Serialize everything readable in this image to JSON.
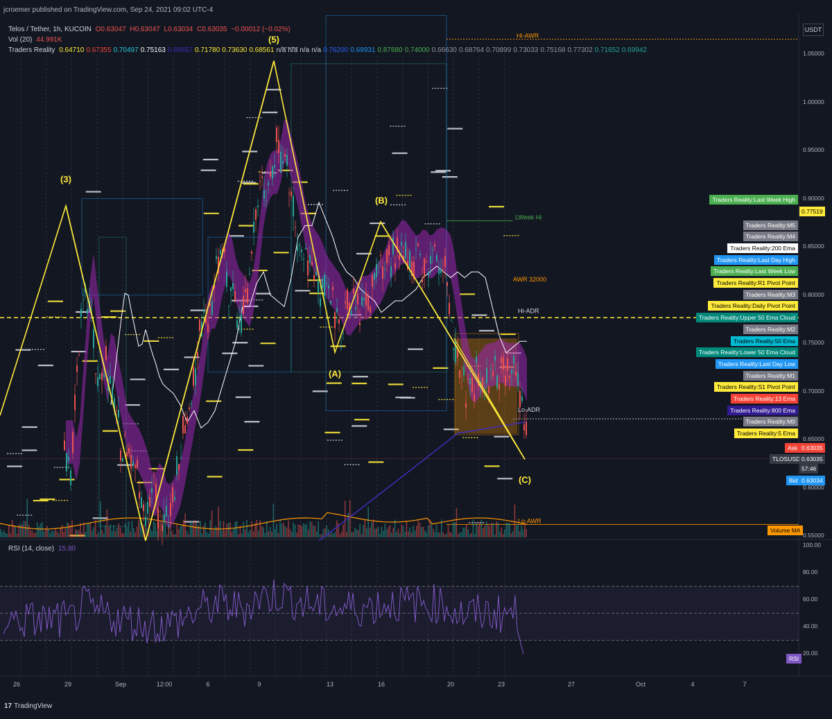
{
  "publish_line": "jcroemer published on TradingView.com, Sep 24, 2021 09:02 UTC-4",
  "footer_brand": "TradingView",
  "header": {
    "symbol": "Telos / Tether, 1h, KUCOIN",
    "o": "O0.63047",
    "h": "H0.63047",
    "l": "L0.63034",
    "c": "C0.63035",
    "chg": "−0.00012 (−0.02%)",
    "vol_label": "Vol (20)",
    "vol_value": "44.991K",
    "tr_label": "Traders Reality",
    "tr_values": [
      {
        "v": "0.64710",
        "c": "#ffeb3b"
      },
      {
        "v": "0.67355",
        "c": "#f44336"
      },
      {
        "v": "0.70497",
        "c": "#26c6da"
      },
      {
        "v": "0.75163",
        "c": "#ffffff"
      },
      {
        "v": "0.66657",
        "c": "#3f2ebd"
      },
      {
        "v": "0.71780",
        "c": "#ffeb3b"
      },
      {
        "v": "0.73630",
        "c": "#ffeb3b"
      },
      {
        "v": "0.68561",
        "c": "#ffeb3b"
      },
      {
        "v": "n/a",
        "c": "#d1d4dc"
      },
      {
        "v": "n/a",
        "c": "#d1d4dc"
      },
      {
        "v": "n/a",
        "c": "#d1d4dc"
      },
      {
        "v": "n/a",
        "c": "#d1d4dc"
      },
      {
        "v": "0.76200",
        "c": "#2962ff"
      },
      {
        "v": "0.69931",
        "c": "#2196f3"
      },
      {
        "v": "0.87680",
        "c": "#4caf50"
      },
      {
        "v": "0.74000",
        "c": "#4caf50"
      },
      {
        "v": "0.66630",
        "c": "#9598a1"
      },
      {
        "v": "0.68764",
        "c": "#9598a1"
      },
      {
        "v": "0.70899",
        "c": "#9598a1"
      },
      {
        "v": "0.73033",
        "c": "#9598a1"
      },
      {
        "v": "0.75168",
        "c": "#9598a1"
      },
      {
        "v": "0.77302",
        "c": "#9598a1"
      },
      {
        "v": "0.71652",
        "c": "#26a69a"
      },
      {
        "v": "0.69942",
        "c": "#26a69a"
      }
    ]
  },
  "currency": "USDT",
  "rsi_label": "RSI (14, close)",
  "rsi_value": "15.80",
  "rsi_tag": "RSI",
  "ask_label": "Ask",
  "ask_value": "0.63035",
  "sym_label": "TLOSUSDT",
  "sym_value": "0.63035",
  "countdown": "57:46",
  "bid_label": "Bid",
  "bid_value": "0.63034",
  "last_week_high_value": "0.77519",
  "volume_ma_tag": "Volume MA",
  "colors": {
    "background": "#131722",
    "up": "#26a69a",
    "down": "#ef5350",
    "ema_cloud": "#9c27b0",
    "elliott": "#ffeb3b"
  },
  "right_tags": [
    {
      "text": "Traders Reality:Last Week High",
      "bg": "#4caf50",
      "fg": "#ffffff",
      "price": 0.899
    },
    {
      "text": "Traders Reality:M5",
      "bg": "#787b86",
      "fg": "#ffffff",
      "price": 0.8725
    },
    {
      "text": "Traders Reality:M4",
      "bg": "#787b86",
      "fg": "#ffffff",
      "price": 0.8605
    },
    {
      "text": "Traders Reality:200 Ema",
      "bg": "#ffffff",
      "fg": "#000000",
      "price": 0.8485
    },
    {
      "text": "Traders Reality:Last Day High",
      "bg": "#2196f3",
      "fg": "#ffffff",
      "price": 0.8365
    },
    {
      "text": "Traders Reality:Last Week Low",
      "bg": "#4caf50",
      "fg": "#ffffff",
      "price": 0.8245
    },
    {
      "text": "Traders Reality:R1 Pivot Point",
      "bg": "#ffeb3b",
      "fg": "#000000",
      "price": 0.8125
    },
    {
      "text": "Traders Reality:M3",
      "bg": "#787b86",
      "fg": "#ffffff",
      "price": 0.8005
    },
    {
      "text": "Traders Reality:Daily Pivot Point",
      "bg": "#ffeb3b",
      "fg": "#000000",
      "price": 0.7885
    },
    {
      "text": "Traders Reality:Upper 50 Ema Cloud",
      "bg": "#00897b",
      "fg": "#ffffff",
      "price": 0.7765
    },
    {
      "text": "Traders Reality:M2",
      "bg": "#787b86",
      "fg": "#ffffff",
      "price": 0.7645
    },
    {
      "text": "Traders Reality:50 Ema",
      "bg": "#00bcd4",
      "fg": "#000000",
      "price": 0.7525
    },
    {
      "text": "Traders Reality:Lower 50 Ema Cloud",
      "bg": "#00897b",
      "fg": "#ffffff",
      "price": 0.7405
    },
    {
      "text": "Traders Reality:Last Day Low",
      "bg": "#2196f3",
      "fg": "#ffffff",
      "price": 0.7285
    },
    {
      "text": "Traders Reality:M1",
      "bg": "#787b86",
      "fg": "#ffffff",
      "price": 0.7165
    },
    {
      "text": "Traders Reality:S1 Pivot Point",
      "bg": "#ffeb3b",
      "fg": "#000000",
      "price": 0.7045
    },
    {
      "text": "Traders Reality:13 Ema",
      "bg": "#f44336",
      "fg": "#ffffff",
      "price": 0.6925
    },
    {
      "text": "Traders Reality:800 Ema",
      "bg": "#311b92",
      "fg": "#ffffff",
      "price": 0.6805
    },
    {
      "text": "Traders Reality:M0",
      "bg": "#787b86",
      "fg": "#ffffff",
      "price": 0.6685
    },
    {
      "text": "Traders Reality:5 Ema",
      "bg": "#ffeb3b",
      "fg": "#000000",
      "price": 0.6565
    }
  ],
  "level_labels": [
    {
      "text": "Hi-AWR",
      "color": "#ff9800",
      "price": 1.0655
    },
    {
      "text": "LWeek Hi",
      "color": "#4caf50",
      "price": 0.877
    },
    {
      "text": "AWR 32000",
      "color": "#ff9800",
      "price": 0.8125
    },
    {
      "text": "Hi-ADR",
      "color": "#d1d4dc",
      "price": 0.78
    },
    {
      "text": "Lo-ADR",
      "color": "#d1d4dc",
      "price": 0.6775
    },
    {
      "text": "Lo-AWR",
      "color": "#ff9800",
      "price": 0.562
    }
  ],
  "chart_data": {
    "type": "candlestick",
    "symbol": "TLOSUSDT",
    "ylim": [
      0.545,
      1.09
    ],
    "y_ticks": [
      "1.05000",
      "1.00000",
      "0.95000",
      "0.90000",
      "0.85000",
      "0.80000",
      "0.75000",
      "0.70000",
      "0.65000",
      "0.60000",
      "0.55000"
    ],
    "x_ticks": [
      {
        "label": "26",
        "x": 24
      },
      {
        "label": "29",
        "x": 98
      },
      {
        "label": "Sep",
        "x": 174
      },
      {
        "label": "12:00",
        "x": 237
      },
      {
        "label": "6",
        "x": 300
      },
      {
        "label": "9",
        "x": 374
      },
      {
        "label": "13",
        "x": 476
      },
      {
        "label": "16",
        "x": 550
      },
      {
        "label": "20",
        "x": 650
      },
      {
        "label": "23",
        "x": 723
      },
      {
        "label": "27",
        "x": 824
      },
      {
        "label": "Oct",
        "x": 924
      },
      {
        "label": "4",
        "x": 999
      },
      {
        "label": "7",
        "x": 1074
      }
    ],
    "price_path": [
      [
        95,
        0.64
      ],
      [
        100,
        0.61
      ],
      [
        108,
        0.69
      ],
      [
        115,
        0.76
      ],
      [
        122,
        0.82
      ],
      [
        128,
        0.78
      ],
      [
        135,
        0.74
      ],
      [
        142,
        0.7
      ],
      [
        150,
        0.74
      ],
      [
        158,
        0.705
      ],
      [
        165,
        0.68
      ],
      [
        172,
        0.65
      ],
      [
        180,
        0.64
      ],
      [
        190,
        0.63
      ],
      [
        200,
        0.61
      ],
      [
        210,
        0.58
      ],
      [
        220,
        0.6
      ],
      [
        230,
        0.57
      ],
      [
        240,
        0.58
      ],
      [
        250,
        0.6
      ],
      [
        260,
        0.64
      ],
      [
        270,
        0.68
      ],
      [
        280,
        0.72
      ],
      [
        290,
        0.78
      ],
      [
        300,
        0.78
      ],
      [
        310,
        0.82
      ],
      [
        320,
        0.84
      ],
      [
        330,
        0.8
      ],
      [
        340,
        0.79
      ],
      [
        350,
        0.78
      ],
      [
        360,
        0.83
      ],
      [
        370,
        0.9
      ],
      [
        380,
        0.92
      ],
      [
        390,
        0.92
      ],
      [
        400,
        0.96
      ],
      [
        410,
        0.93
      ],
      [
        420,
        0.9
      ],
      [
        430,
        0.86
      ],
      [
        440,
        0.84
      ],
      [
        450,
        0.83
      ],
      [
        460,
        0.81
      ],
      [
        470,
        0.8
      ],
      [
        480,
        0.79
      ],
      [
        490,
        0.77
      ],
      [
        500,
        0.78
      ],
      [
        510,
        0.79
      ],
      [
        520,
        0.79
      ],
      [
        530,
        0.8
      ],
      [
        540,
        0.81
      ],
      [
        550,
        0.83
      ],
      [
        560,
        0.84
      ],
      [
        570,
        0.85
      ],
      [
        580,
        0.84
      ],
      [
        590,
        0.83
      ],
      [
        600,
        0.84
      ],
      [
        610,
        0.83
      ],
      [
        620,
        0.84
      ],
      [
        630,
        0.84
      ],
      [
        640,
        0.83
      ],
      [
        650,
        0.78
      ],
      [
        660,
        0.73
      ],
      [
        670,
        0.7
      ],
      [
        680,
        0.71
      ],
      [
        690,
        0.72
      ],
      [
        700,
        0.72
      ],
      [
        710,
        0.725
      ],
      [
        720,
        0.72
      ],
      [
        730,
        0.72
      ],
      [
        740,
        0.72
      ],
      [
        750,
        0.7
      ],
      [
        756,
        0.66
      ],
      [
        760,
        0.63
      ]
    ],
    "elliott_wave": [
      {
        "label": "(3)",
        "x": 95,
        "price": 0.8925
      },
      {
        "label": "",
        "x": 210,
        "price": 0.545
      },
      {
        "label": "(5)",
        "x": 395,
        "price": 1.043
      },
      {
        "label": "(A)",
        "x": 483,
        "price": 0.7405
      },
      {
        "label": "(B)",
        "x": 549,
        "price": 0.876
      },
      {
        "label": "(C)",
        "x": 757,
        "price": 0.6295
      }
    ],
    "dashed_level": 0.7765,
    "last_price": 0.63035,
    "rsi": {
      "ylim": [
        10,
        100
      ],
      "ticks": [
        "100.00",
        "80.00",
        "60.00",
        "40.00",
        "20.00"
      ],
      "bands": [
        30,
        70
      ],
      "last": 15.8
    }
  }
}
